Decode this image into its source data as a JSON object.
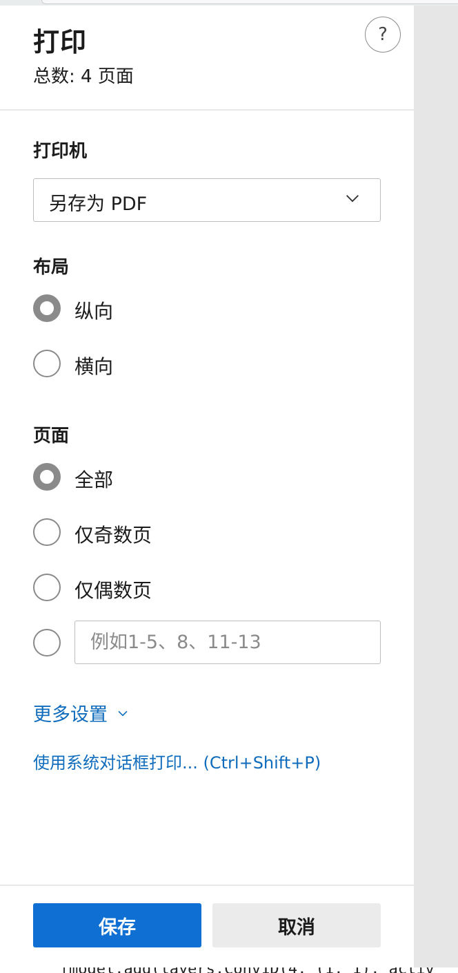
{
  "header": {
    "title": "打印",
    "total_pages": "总数: 4 页面",
    "help_label": "?"
  },
  "printer": {
    "label": "打印机",
    "selected": "另存为 PDF"
  },
  "layout": {
    "label": "布局",
    "options": [
      {
        "label": "纵向",
        "checked": true
      },
      {
        "label": "横向",
        "checked": false
      }
    ]
  },
  "pages": {
    "label": "页面",
    "options": [
      {
        "label": "全部",
        "checked": true
      },
      {
        "label": "仅奇数页",
        "checked": false
      },
      {
        "label": "仅偶数页",
        "checked": false
      }
    ],
    "custom_range": {
      "checked": false,
      "value": "",
      "placeholder": "例如1-5、8、11-13"
    }
  },
  "more_settings": "更多设置",
  "system_dialog_link": "使用系统对话框打印... (Ctrl+Shift+P)",
  "footer": {
    "save_label": "保存",
    "cancel_label": "取消"
  },
  "background_code": "model.add(layers.Conv1D(4, (1, 1), activ",
  "colors": {
    "accent": "#0f6fd2",
    "link": "#0f6cbd",
    "radio": "#8a8a8a",
    "cancel_bg": "#ebebeb"
  }
}
